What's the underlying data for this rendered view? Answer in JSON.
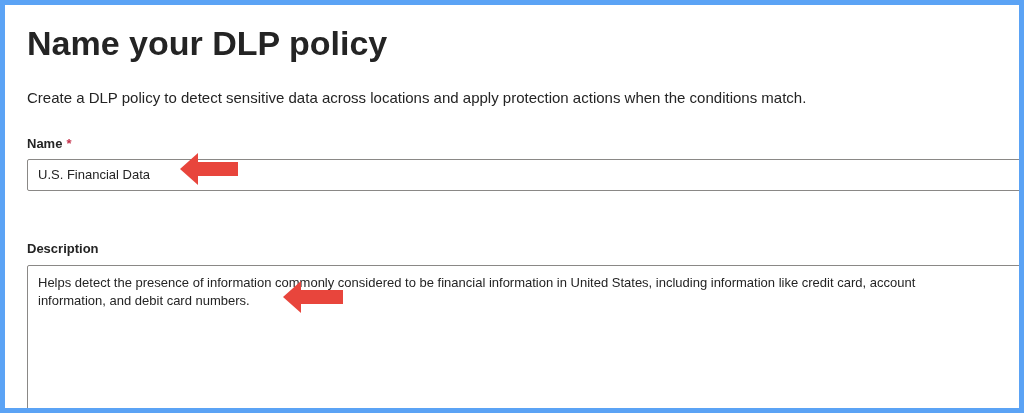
{
  "heading": "Name your DLP policy",
  "intro": "Create a DLP policy to detect sensitive data across locations and apply protection actions when the conditions match.",
  "fields": [
    {
      "kind": "input",
      "label": "Name",
      "required_mark": "*",
      "value": "U.S. Financial Data"
    },
    {
      "kind": "textarea",
      "label": "Description",
      "value": "Helps detect the presence of information commonly considered to be financial information in United States, including information like credit card, account information, and debit card numbers."
    }
  ]
}
